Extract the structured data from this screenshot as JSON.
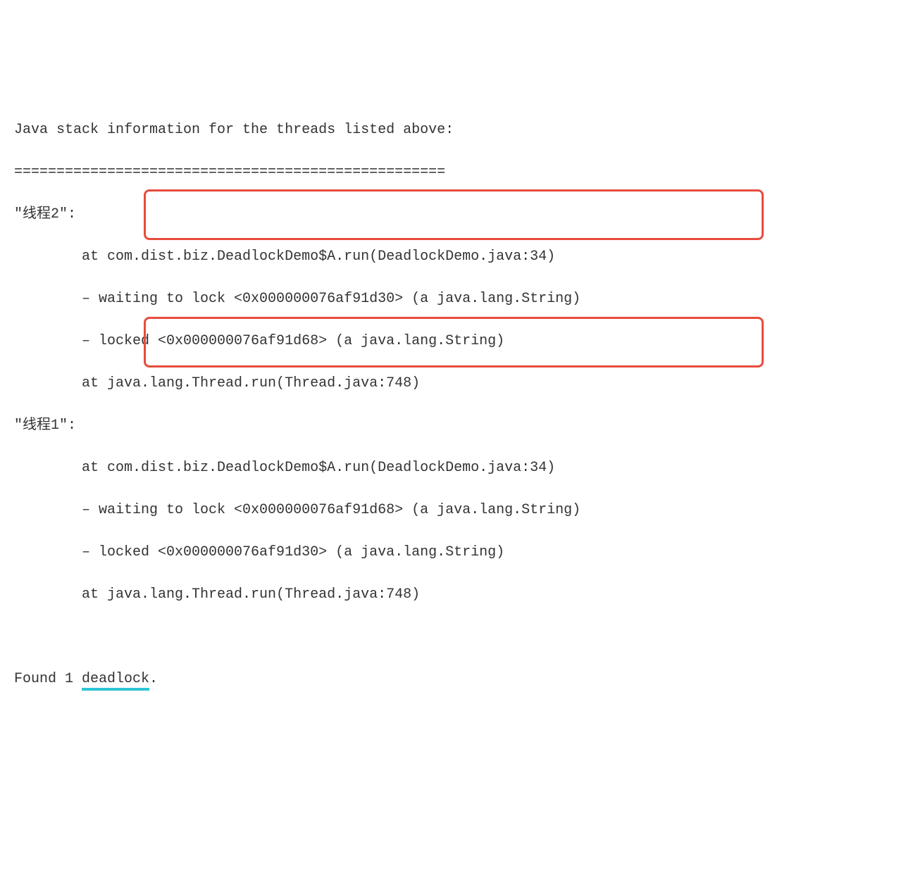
{
  "header": {
    "title": "Java stack information for the threads listed above:",
    "separator": "==================================================="
  },
  "threads": [
    {
      "name": "\"线程2\":",
      "stack": [
        "at com.dist.biz.DeadlockDemo$A.run(DeadlockDemo.java:34)",
        "– waiting to lock <0x000000076af91d30> (a java.lang.String)",
        "– locked <0x000000076af91d68> (a java.lang.String)",
        "at java.lang.Thread.run(Thread.java:748)"
      ]
    },
    {
      "name": "\"线程1\":",
      "stack": [
        "at com.dist.biz.DeadlockDemo$A.run(DeadlockDemo.java:34)",
        "– waiting to lock <0x000000076af91d68> (a java.lang.String)",
        "– locked <0x000000076af91d30> (a java.lang.String)",
        "at java.lang.Thread.run(Thread.java:748)"
      ]
    }
  ],
  "footer": {
    "prefix": "Found 1 ",
    "highlighted": "deadlock",
    "suffix": "."
  }
}
